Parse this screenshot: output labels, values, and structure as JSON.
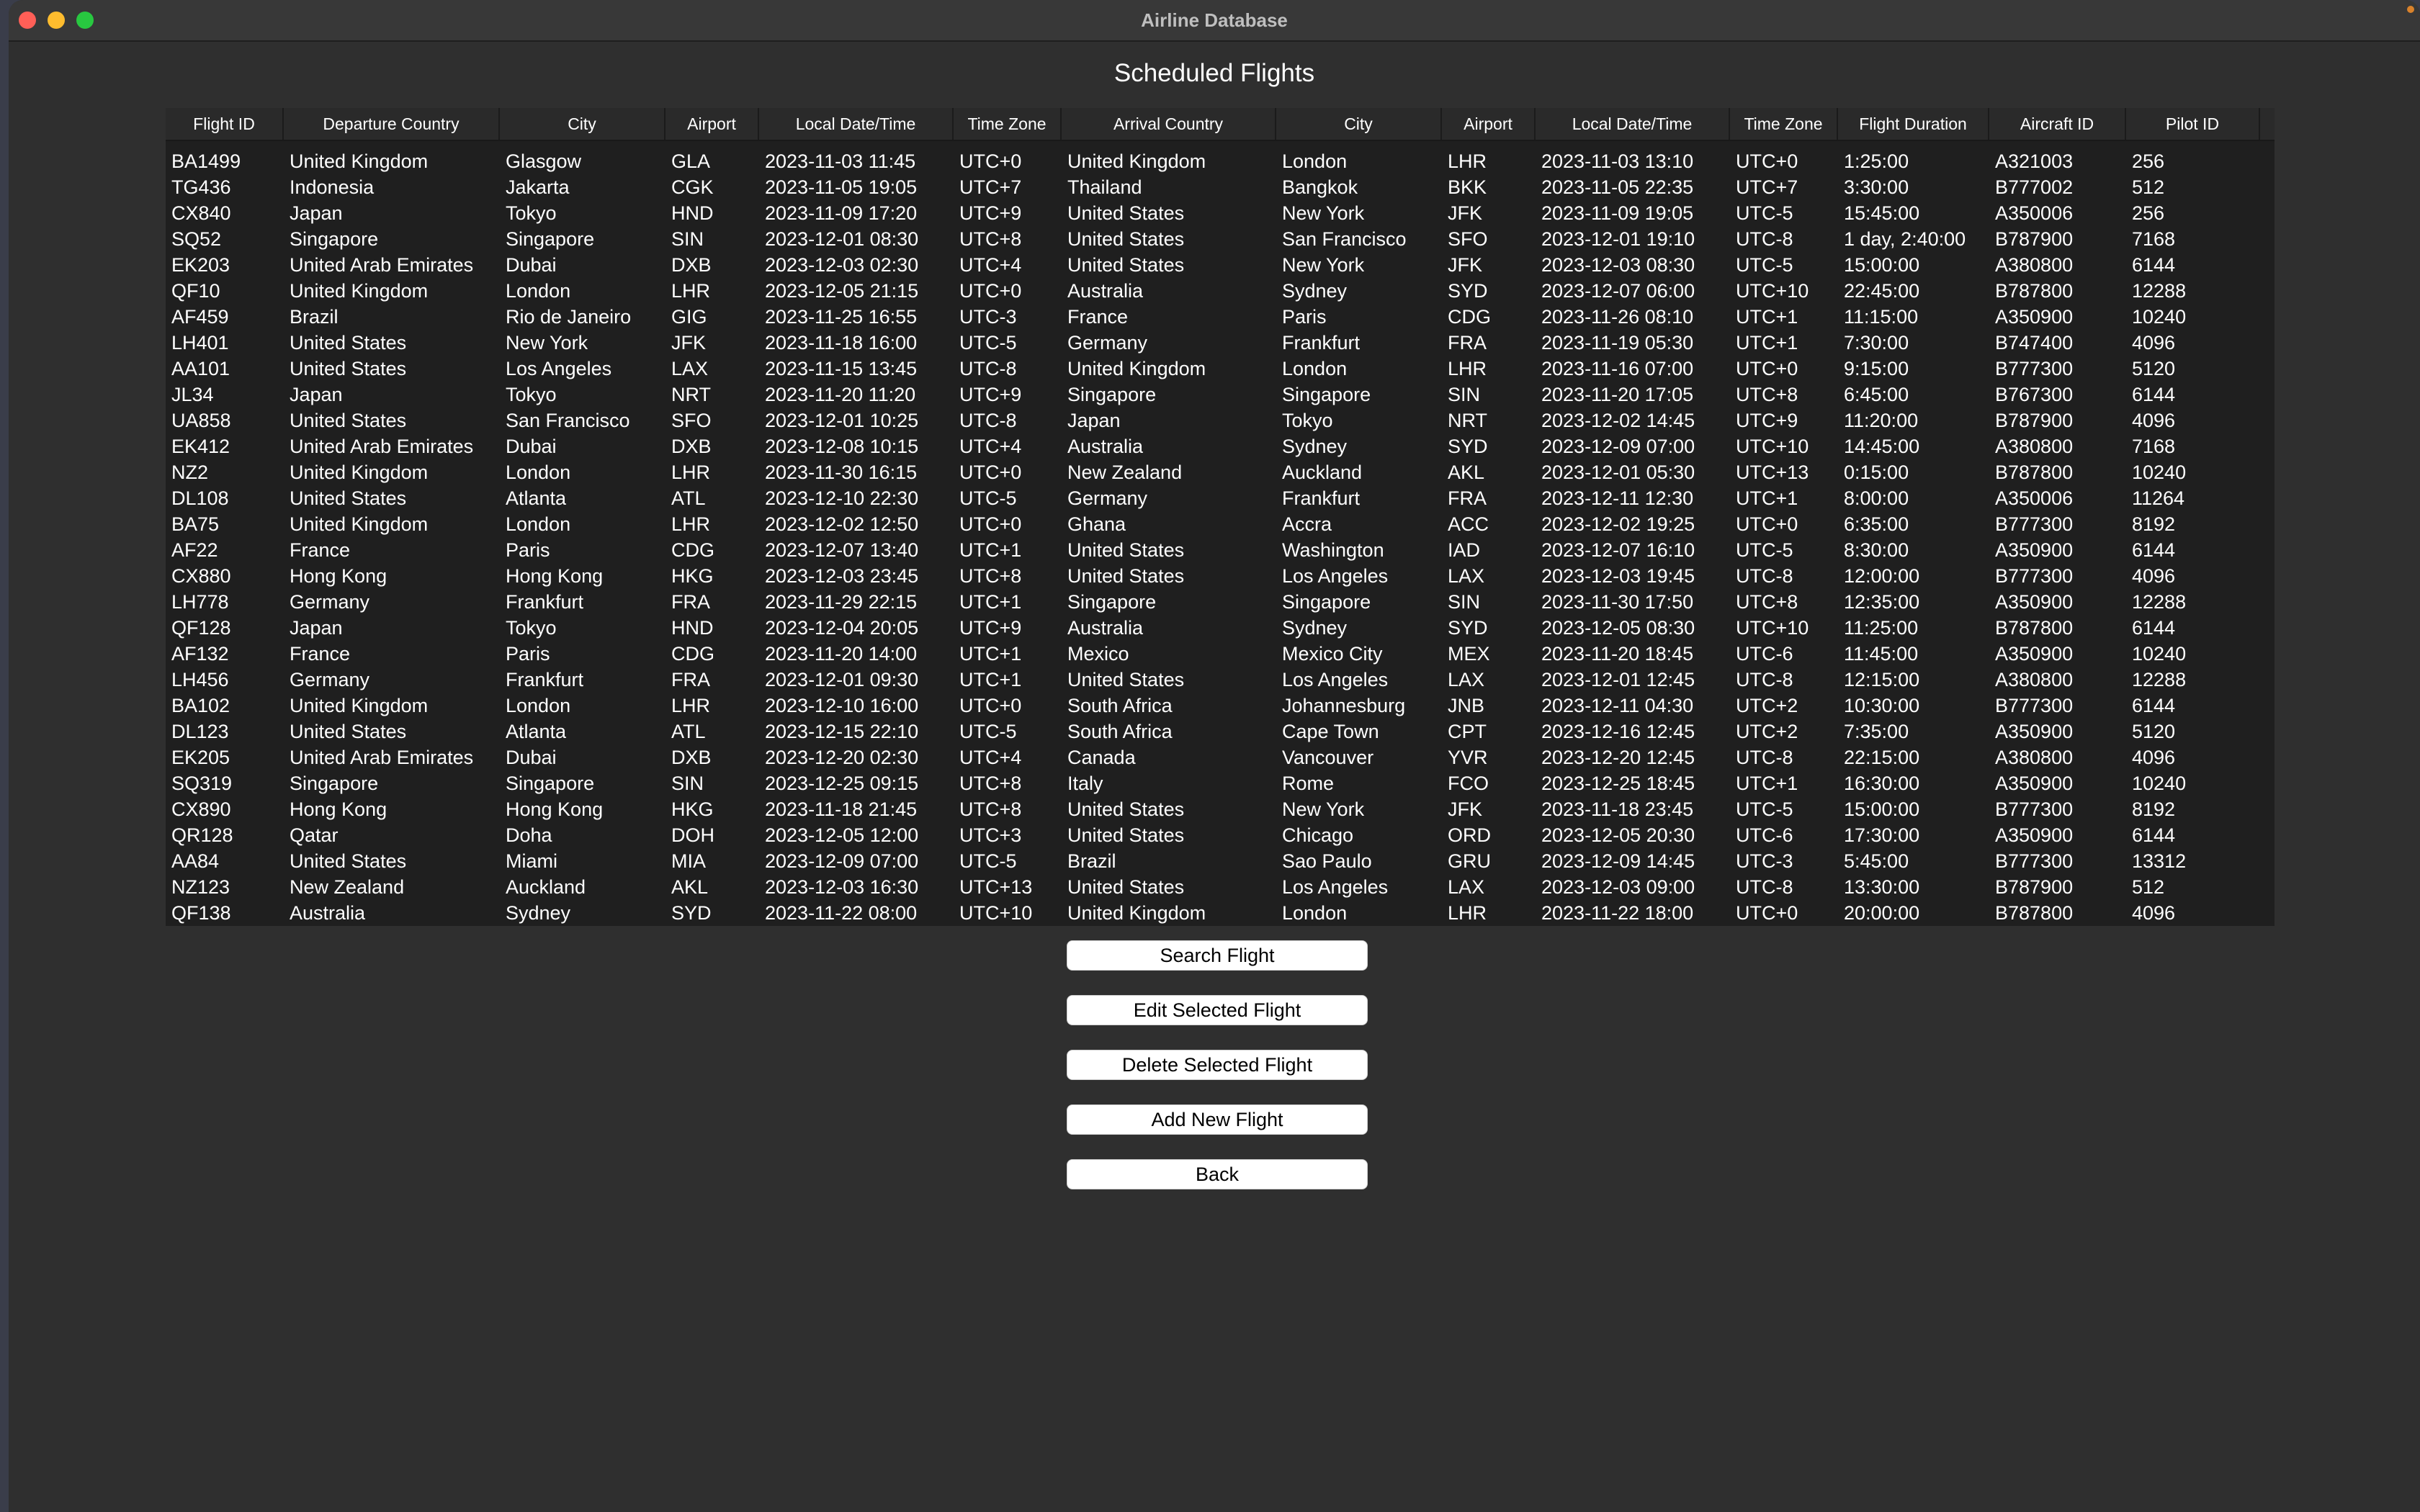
{
  "window": {
    "title": "Airline Database"
  },
  "page": {
    "title": "Scheduled Flights"
  },
  "table": {
    "columns": [
      "Flight ID",
      "Departure Country",
      "City",
      "Airport",
      "Local Date/Time",
      "Time Zone",
      "Arrival Country",
      "City",
      "Airport",
      "Local Date/Time",
      "Time Zone",
      "Flight Duration",
      "Aircraft ID",
      "Pilot ID"
    ],
    "rows": [
      [
        "BA1499",
        "United Kingdom",
        "Glasgow",
        "GLA",
        "2023-11-03 11:45",
        "UTC+0",
        "United Kingdom",
        "London",
        "LHR",
        "2023-11-03 13:10",
        "UTC+0",
        "1:25:00",
        "A321003",
        "256"
      ],
      [
        "TG436",
        "Indonesia",
        "Jakarta",
        "CGK",
        "2023-11-05 19:05",
        "UTC+7",
        "Thailand",
        "Bangkok",
        "BKK",
        "2023-11-05 22:35",
        "UTC+7",
        "3:30:00",
        "B777002",
        "512"
      ],
      [
        "CX840",
        "Japan",
        "Tokyo",
        "HND",
        "2023-11-09 17:20",
        "UTC+9",
        "United States",
        "New York",
        "JFK",
        "2023-11-09 19:05",
        "UTC-5",
        "15:45:00",
        "A350006",
        "256"
      ],
      [
        "SQ52",
        "Singapore",
        "Singapore",
        "SIN",
        "2023-12-01 08:30",
        "UTC+8",
        "United States",
        "San Francisco",
        "SFO",
        "2023-12-01 19:10",
        "UTC-8",
        "1 day, 2:40:00",
        "B787900",
        "7168"
      ],
      [
        "EK203",
        "United Arab Emirates",
        "Dubai",
        "DXB",
        "2023-12-03 02:30",
        "UTC+4",
        "United States",
        "New York",
        "JFK",
        "2023-12-03 08:30",
        "UTC-5",
        "15:00:00",
        "A380800",
        "6144"
      ],
      [
        "QF10",
        "United Kingdom",
        "London",
        "LHR",
        "2023-12-05 21:15",
        "UTC+0",
        "Australia",
        "Sydney",
        "SYD",
        "2023-12-07 06:00",
        "UTC+10",
        "22:45:00",
        "B787800",
        "12288"
      ],
      [
        "AF459",
        "Brazil",
        "Rio de Janeiro",
        "GIG",
        "2023-11-25 16:55",
        "UTC-3",
        "France",
        "Paris",
        "CDG",
        "2023-11-26 08:10",
        "UTC+1",
        "11:15:00",
        "A350900",
        "10240"
      ],
      [
        "LH401",
        "United States",
        "New York",
        "JFK",
        "2023-11-18 16:00",
        "UTC-5",
        "Germany",
        "Frankfurt",
        "FRA",
        "2023-11-19 05:30",
        "UTC+1",
        "7:30:00",
        "B747400",
        "4096"
      ],
      [
        "AA101",
        "United States",
        "Los Angeles",
        "LAX",
        "2023-11-15 13:45",
        "UTC-8",
        "United Kingdom",
        "London",
        "LHR",
        "2023-11-16 07:00",
        "UTC+0",
        "9:15:00",
        "B777300",
        "5120"
      ],
      [
        "JL34",
        "Japan",
        "Tokyo",
        "NRT",
        "2023-11-20 11:20",
        "UTC+9",
        "Singapore",
        "Singapore",
        "SIN",
        "2023-11-20 17:05",
        "UTC+8",
        "6:45:00",
        "B767300",
        "6144"
      ],
      [
        "UA858",
        "United States",
        "San Francisco",
        "SFO",
        "2023-12-01 10:25",
        "UTC-8",
        "Japan",
        "Tokyo",
        "NRT",
        "2023-12-02 14:45",
        "UTC+9",
        "11:20:00",
        "B787900",
        "4096"
      ],
      [
        "EK412",
        "United Arab Emirates",
        "Dubai",
        "DXB",
        "2023-12-08 10:15",
        "UTC+4",
        "Australia",
        "Sydney",
        "SYD",
        "2023-12-09 07:00",
        "UTC+10",
        "14:45:00",
        "A380800",
        "7168"
      ],
      [
        "NZ2",
        "United Kingdom",
        "London",
        "LHR",
        "2023-11-30 16:15",
        "UTC+0",
        "New Zealand",
        "Auckland",
        "AKL",
        "2023-12-01 05:30",
        "UTC+13",
        "0:15:00",
        "B787800",
        "10240"
      ],
      [
        "DL108",
        "United States",
        "Atlanta",
        "ATL",
        "2023-12-10 22:30",
        "UTC-5",
        "Germany",
        "Frankfurt",
        "FRA",
        "2023-12-11 12:30",
        "UTC+1",
        "8:00:00",
        "A350006",
        "11264"
      ],
      [
        "BA75",
        "United Kingdom",
        "London",
        "LHR",
        "2023-12-02 12:50",
        "UTC+0",
        "Ghana",
        "Accra",
        "ACC",
        "2023-12-02 19:25",
        "UTC+0",
        "6:35:00",
        "B777300",
        "8192"
      ],
      [
        "AF22",
        "France",
        "Paris",
        "CDG",
        "2023-12-07 13:40",
        "UTC+1",
        "United States",
        "Washington",
        "IAD",
        "2023-12-07 16:10",
        "UTC-5",
        "8:30:00",
        "A350900",
        "6144"
      ],
      [
        "CX880",
        "Hong Kong",
        "Hong Kong",
        "HKG",
        "2023-12-03 23:45",
        "UTC+8",
        "United States",
        "Los Angeles",
        "LAX",
        "2023-12-03 19:45",
        "UTC-8",
        "12:00:00",
        "B777300",
        "4096"
      ],
      [
        "LH778",
        "Germany",
        "Frankfurt",
        "FRA",
        "2023-11-29 22:15",
        "UTC+1",
        "Singapore",
        "Singapore",
        "SIN",
        "2023-11-30 17:50",
        "UTC+8",
        "12:35:00",
        "A350900",
        "12288"
      ],
      [
        "QF128",
        "Japan",
        "Tokyo",
        "HND",
        "2023-12-04 20:05",
        "UTC+9",
        "Australia",
        "Sydney",
        "SYD",
        "2023-12-05 08:30",
        "UTC+10",
        "11:25:00",
        "B787800",
        "6144"
      ],
      [
        "AF132",
        "France",
        "Paris",
        "CDG",
        "2023-11-20 14:00",
        "UTC+1",
        "Mexico",
        "Mexico City",
        "MEX",
        "2023-11-20 18:45",
        "UTC-6",
        "11:45:00",
        "A350900",
        "10240"
      ],
      [
        "LH456",
        "Germany",
        "Frankfurt",
        "FRA",
        "2023-12-01 09:30",
        "UTC+1",
        "United States",
        "Los Angeles",
        "LAX",
        "2023-12-01 12:45",
        "UTC-8",
        "12:15:00",
        "A380800",
        "12288"
      ],
      [
        "BA102",
        "United Kingdom",
        "London",
        "LHR",
        "2023-12-10 16:00",
        "UTC+0",
        "South Africa",
        "Johannesburg",
        "JNB",
        "2023-12-11 04:30",
        "UTC+2",
        "10:30:00",
        "B777300",
        "6144"
      ],
      [
        "DL123",
        "United States",
        "Atlanta",
        "ATL",
        "2023-12-15 22:10",
        "UTC-5",
        "South Africa",
        "Cape Town",
        "CPT",
        "2023-12-16 12:45",
        "UTC+2",
        "7:35:00",
        "A350900",
        "5120"
      ],
      [
        "EK205",
        "United Arab Emirates",
        "Dubai",
        "DXB",
        "2023-12-20 02:30",
        "UTC+4",
        "Canada",
        "Vancouver",
        "YVR",
        "2023-12-20 12:45",
        "UTC-8",
        "22:15:00",
        "A380800",
        "4096"
      ],
      [
        "SQ319",
        "Singapore",
        "Singapore",
        "SIN",
        "2023-12-25 09:15",
        "UTC+8",
        "Italy",
        "Rome",
        "FCO",
        "2023-12-25 18:45",
        "UTC+1",
        "16:30:00",
        "A350900",
        "10240"
      ],
      [
        "CX890",
        "Hong Kong",
        "Hong Kong",
        "HKG",
        "2023-11-18 21:45",
        "UTC+8",
        "United States",
        "New York",
        "JFK",
        "2023-11-18 23:45",
        "UTC-5",
        "15:00:00",
        "B777300",
        "8192"
      ],
      [
        "QR128",
        "Qatar",
        "Doha",
        "DOH",
        "2023-12-05 12:00",
        "UTC+3",
        "United States",
        "Chicago",
        "ORD",
        "2023-12-05 20:30",
        "UTC-6",
        "17:30:00",
        "A350900",
        "6144"
      ],
      [
        "AA84",
        "United States",
        "Miami",
        "MIA",
        "2023-12-09 07:00",
        "UTC-5",
        "Brazil",
        "Sao Paulo",
        "GRU",
        "2023-12-09 14:45",
        "UTC-3",
        "5:45:00",
        "B777300",
        "13312"
      ],
      [
        "NZ123",
        "New Zealand",
        "Auckland",
        "AKL",
        "2023-12-03 16:30",
        "UTC+13",
        "United States",
        "Los Angeles",
        "LAX",
        "2023-12-03 09:00",
        "UTC-8",
        "13:30:00",
        "B787900",
        "512"
      ],
      [
        "QF138",
        "Australia",
        "Sydney",
        "SYD",
        "2023-11-22 08:00",
        "UTC+10",
        "United Kingdom",
        "London",
        "LHR",
        "2023-11-22 18:00",
        "UTC+0",
        "20:00:00",
        "B787800",
        "4096"
      ]
    ]
  },
  "buttons": {
    "search": "Search Flight",
    "edit": "Edit Selected Flight",
    "delete": "Delete Selected Flight",
    "add": "Add New Flight",
    "back": "Back"
  }
}
